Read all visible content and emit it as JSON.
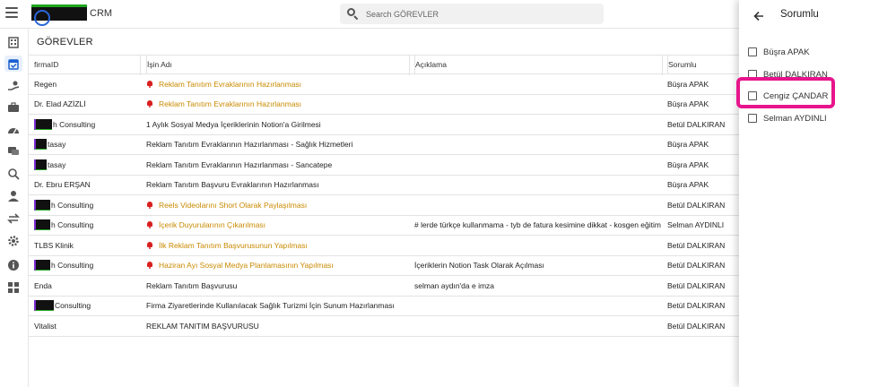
{
  "app": {
    "brand": "CRM"
  },
  "search": {
    "placeholder": "Search GÖREVLER"
  },
  "page": {
    "title": "GÖREVLER"
  },
  "table": {
    "headers": [
      "firmaID",
      "İşin Adı",
      "Açıklama",
      "Sorumlu"
    ],
    "rows": [
      {
        "firma": "Regen",
        "is": "Reklam Tanıtım Evraklarının Hazırlanması",
        "aciklama": "",
        "sorumlu": "Büşra APAK",
        "alert": true,
        "redact": 0
      },
      {
        "firma": "Dr. Elad AZİZLİ",
        "is": "Reklam Tanıtım Evraklarının Hazırlanması",
        "aciklama": "",
        "sorumlu": "Büşra APAK",
        "alert": true,
        "redact": 0
      },
      {
        "firma": "h Consulting",
        "is": "1 Aylık Sosyal Medya İçeriklerinin Notion'a Girilmesi",
        "aciklama": "",
        "sorumlu": "Betül DALKIRAN",
        "alert": false,
        "redact": 20
      },
      {
        "firma": "tasay",
        "is": "Reklam Tanıtım Evraklarının Hazırlanması - Sağlık Hizmetleri",
        "aciklama": "",
        "sorumlu": "Büşra APAK",
        "alert": false,
        "redact": 14
      },
      {
        "firma": "tasay",
        "is": "Reklam Tanıtım Evraklarının Hazırlanması - Sancatepe",
        "aciklama": "",
        "sorumlu": "Büşra APAK",
        "alert": false,
        "redact": 14
      },
      {
        "firma": "Dr. Ebru ERŞAN",
        "is": "Reklam Tanıtım Başvuru Evraklarının Hazırlanması",
        "aciklama": "",
        "sorumlu": "Büşra APAK",
        "alert": false,
        "redact": 0
      },
      {
        "firma": "h Consulting",
        "is": "Reels Videolarını Short Olarak Paylaşılması",
        "aciklama": "",
        "sorumlu": "Betül DALKIRAN",
        "alert": true,
        "redact": 18
      },
      {
        "firma": "h Consulting",
        "is": "İçerik Duyurularının Çıkarılması",
        "aciklama": "# lerde türkçe kullanmama - tyb de fatura kesimine dikkat - kosgen eğitim tama...",
        "sorumlu": "Selman AYDINLI",
        "alert": true,
        "redact": 18
      },
      {
        "firma": "TLBS Klinik",
        "is": "İlk Reklam Tanıtım Başvurusunun Yapılması",
        "aciklama": "",
        "sorumlu": "Betül DALKIRAN",
        "alert": true,
        "redact": 0
      },
      {
        "firma": "h Consulting",
        "is": "Haziran Ayı Sosyal Medya Planlamasının Yapılması",
        "aciklama": "İçeriklerin Notion Task Olarak Açılması",
        "sorumlu": "Betül DALKIRAN",
        "alert": true,
        "redact": 18
      },
      {
        "firma": "Enda",
        "is": "Reklam Tanıtım Başvurusu",
        "aciklama": "selman aydın'da e imza",
        "sorumlu": "Betül DALKIRAN",
        "alert": false,
        "redact": 0
      },
      {
        "firma": "Consulting",
        "is": "Firma Ziyaretlerinde Kullanılacak Sağlık Turizmi İçin Sunum Hazırlanması",
        "aciklama": "",
        "sorumlu": "Betül DALKIRAN",
        "alert": false,
        "redact": 22
      },
      {
        "firma": "Vitalist",
        "is": "REKLAM TANITIM BAŞVURUSU",
        "aciklama": "",
        "sorumlu": "Betül DALKIRAN",
        "alert": false,
        "redact": 0
      }
    ]
  },
  "panel": {
    "title": "Sorumlu",
    "options": [
      "Büşra APAK",
      "Betül DALKIRAN",
      "Cengiz ÇANDAR",
      "Selman AYDINLI"
    ]
  },
  "colors": {
    "alert_text": "#c98a00",
    "bell": "#d92020",
    "highlight": "#e8148c"
  },
  "icons": [
    "menu-icon",
    "search-icon",
    "building-icon",
    "calendar-check-icon",
    "hand-money-icon",
    "briefcase-icon",
    "gauge-icon",
    "chat-icon",
    "magnify-icon",
    "person-icon",
    "refresh-icon",
    "gear-icon",
    "info-icon",
    "grid-icon",
    "arrow-left-icon"
  ]
}
